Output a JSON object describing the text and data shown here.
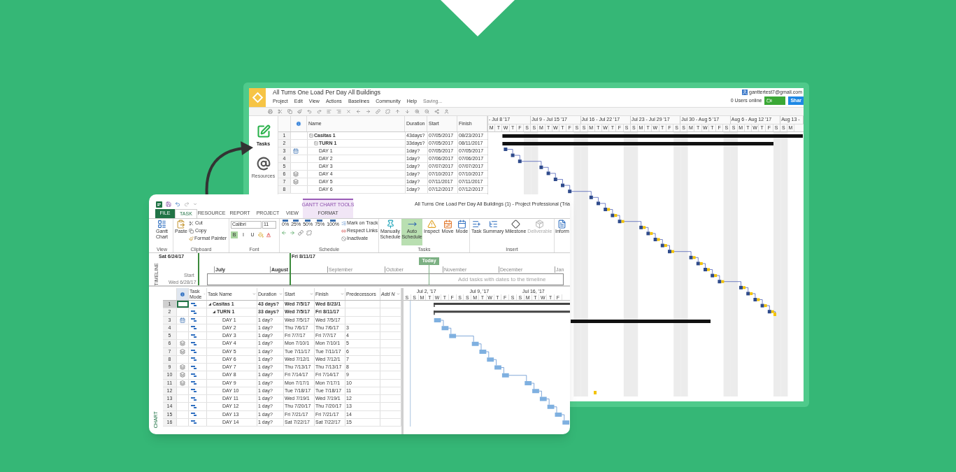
{
  "back_window": {
    "title": "All Turns One Load Per Day All Buildings",
    "menu": [
      "Project",
      "Edit",
      "View",
      "Actions",
      "Baselines",
      "Community",
      "Help"
    ],
    "status": "Saving...",
    "account": "ganttertest7@gmail.com",
    "users_online": "0 Users online",
    "share_button": "Shar",
    "sidebar": [
      {
        "label": "Tasks",
        "selected": true
      },
      {
        "label": "Resources",
        "selected": false
      }
    ],
    "table": {
      "columns": [
        "Name",
        "Duration",
        "Start",
        "Finish"
      ],
      "rows": [
        {
          "id": "1",
          "name": "Casitas 1",
          "duration": "43days?",
          "start": "07/05/2017",
          "finish": "08/23/2017",
          "kind": "summary",
          "expanded": true,
          "children": [
            {
              "id": "2",
              "name": "TURN 1",
              "duration": "33days?",
              "start": "07/05/2017",
              "finish": "08/11/2017",
              "kind": "summary",
              "expanded": true,
              "children": [
                {
                  "id": "3",
                  "name": "DAY 1",
                  "duration": "1day?",
                  "start": "07/05/2017",
                  "finish": "07/05/2017",
                  "kind": "calendar"
                },
                {
                  "id": "4",
                  "name": "DAY 2",
                  "duration": "1day?",
                  "start": "07/06/2017",
                  "finish": "07/06/2017",
                  "kind": "task"
                },
                {
                  "id": "5",
                  "name": "DAY 3",
                  "duration": "1day?",
                  "start": "07/07/2017",
                  "finish": "07/07/2017",
                  "kind": "task"
                },
                {
                  "id": "6",
                  "name": "DAY 4",
                  "duration": "1day?",
                  "start": "07/10/2017",
                  "finish": "07/10/2017",
                  "kind": "layers"
                },
                {
                  "id": "7",
                  "name": "DAY 5",
                  "duration": "1day?",
                  "start": "07/11/2017",
                  "finish": "07/11/2017",
                  "kind": "layers"
                },
                {
                  "id": "8",
                  "name": "DAY 6",
                  "duration": "1day?",
                  "start": "07/12/2017",
                  "finish": "07/12/2017",
                  "kind": "task"
                }
              ]
            }
          ]
        }
      ]
    },
    "gantt": {
      "weeks": [
        {
          "label": "- Jul 8 '17",
          "days": [
            "M",
            "T",
            "W",
            "T",
            "F",
            "S"
          ]
        },
        {
          "label": "Jul 9 - Jul 15 '17",
          "days": [
            "S",
            "M",
            "T",
            "W",
            "T",
            "F",
            "S"
          ]
        },
        {
          "label": "Jul 16 - Jul 22 '17",
          "days": [
            "S",
            "M",
            "T",
            "W",
            "T",
            "F",
            "S"
          ]
        },
        {
          "label": "Jul 23 - Jul 29 '17",
          "days": [
            "S",
            "M",
            "T",
            "W",
            "T",
            "F",
            "S"
          ]
        },
        {
          "label": "Jul 30 - Aug 5 '17",
          "days": [
            "S",
            "M",
            "T",
            "W",
            "T",
            "F",
            "S"
          ]
        },
        {
          "label": "Aug 6 - Aug 12 '17",
          "days": [
            "S",
            "M",
            "T",
            "W",
            "T",
            "F",
            "S"
          ]
        },
        {
          "label": "Aug 13 -",
          "days": [
            "S",
            "M"
          ]
        }
      ]
    }
  },
  "front_window": {
    "contextual_group": "GANTT CHART TOOLS",
    "title": "All Turns One Load Per Day All Buildings (1) - Project Professional (Tria",
    "tabs": [
      {
        "label": "FILE",
        "kind": "file",
        "selected": false
      },
      {
        "label": "TASK",
        "kind": "normal",
        "selected": true
      },
      {
        "label": "RESOURCE",
        "kind": "normal",
        "selected": false
      },
      {
        "label": "REPORT",
        "kind": "normal",
        "selected": false
      },
      {
        "label": "PROJECT",
        "kind": "normal",
        "selected": false
      },
      {
        "label": "VIEW",
        "kind": "normal",
        "selected": false
      },
      {
        "label": "FORMAT",
        "kind": "contextual",
        "selected": false
      }
    ],
    "ribbon": {
      "view": {
        "label": "View",
        "gantt_chart": "Gantt Chart"
      },
      "clipboard": {
        "label": "Clipboard",
        "paste": "Paste",
        "cut": "Cut",
        "copy": "Copy",
        "format_painter": "Format Painter"
      },
      "font": {
        "label": "Font",
        "font_name": "Calibri",
        "font_size": "11",
        "styles": [
          {
            "label": "B",
            "selected": true
          },
          {
            "label": "I",
            "selected": false
          },
          {
            "label": "U",
            "selected": false
          }
        ]
      },
      "schedule": {
        "label": "Schedule",
        "percent_buttons": [
          "0%",
          "25%",
          "50%",
          "75%",
          "100%"
        ],
        "mark_on_track": "Mark on Track",
        "respect_links": "Respect Links",
        "inactivate": "Inactivate"
      },
      "tasks": {
        "label": "Tasks",
        "schedule_modes": [
          {
            "label": "Manually Schedule",
            "selected": false
          },
          {
            "label": "Auto Schedule",
            "selected": true
          }
        ],
        "buttons": [
          "Inspect",
          "Move",
          "Mode"
        ]
      },
      "insert": {
        "label": "Insert",
        "buttons": [
          {
            "label": "Task",
            "disabled": false
          },
          {
            "label": "Summary",
            "disabled": false
          },
          {
            "label": "Milestone",
            "disabled": false
          },
          {
            "label": "Deliverable",
            "disabled": true
          }
        ]
      },
      "cut_button": "Inform"
    },
    "timeline": {
      "label": "TIMELINE",
      "start_date": "Sat 6/24/17",
      "finish_date": "Fri 8/11/17",
      "today": "Today",
      "months": [
        "July",
        "August",
        "September",
        "October",
        "November",
        "December",
        "Jan"
      ],
      "start_label": "Start",
      "start_value": "Wed 6/28/17",
      "placeholder": "Add tasks with dates to the timeline"
    },
    "table": {
      "columns": [
        "Task Mode",
        "Task Name",
        "Duration",
        "Start",
        "Finish",
        "Predecessors",
        "Add N"
      ],
      "rows": [
        {
          "id": "1",
          "name": "Casitas 1",
          "duration": "43 days?",
          "start": "Wed 7/5/17",
          "finish": "Wed 8/23/1",
          "kind": "summary",
          "selected": true,
          "expanded": true,
          "children": [
            {
              "id": "2",
              "name": "TURN 1",
              "duration": "33 days?",
              "start": "Wed 7/5/17",
              "finish": "Fri 8/11/17",
              "kind": "summary",
              "selected": false,
              "expanded": true,
              "children": [
                {
                  "id": "3",
                  "name": "DAY 1",
                  "duration": "1 day?",
                  "start": "Wed 7/5/17",
                  "finish": "Wed 7/5/17",
                  "kind": "calendar",
                  "selected": false
                },
                {
                  "id": "4",
                  "name": "DAY 2",
                  "duration": "1 day?",
                  "start": "Thu 7/6/17",
                  "finish": "Thu 7/6/17",
                  "predecessors": "3",
                  "kind": "task",
                  "selected": false
                },
                {
                  "id": "5",
                  "name": "DAY 3",
                  "duration": "1 day?",
                  "start": "Fri 7/7/17",
                  "finish": "Fri 7/7/17",
                  "predecessors": "4",
                  "kind": "task",
                  "selected": false
                },
                {
                  "id": "6",
                  "name": "DAY 4",
                  "duration": "1 day?",
                  "start": "Mon 7/10/1",
                  "finish": "Mon 7/10/1",
                  "predecessors": "5",
                  "kind": "layers",
                  "selected": false
                },
                {
                  "id": "7",
                  "name": "DAY 5",
                  "duration": "1 day?",
                  "start": "Tue 7/11/17",
                  "finish": "Tue 7/11/17",
                  "predecessors": "6",
                  "kind": "layers",
                  "selected": false
                },
                {
                  "id": "8",
                  "name": "DAY 6",
                  "duration": "1 day?",
                  "start": "Wed 7/12/1",
                  "finish": "Wed 7/12/1",
                  "predecessors": "7",
                  "kind": "task",
                  "selected": false
                },
                {
                  "id": "9",
                  "name": "DAY 7",
                  "duration": "1 day?",
                  "start": "Thu 7/13/17",
                  "finish": "Thu 7/13/17",
                  "predecessors": "8",
                  "kind": "layers",
                  "selected": false
                },
                {
                  "id": "10",
                  "name": "DAY 8",
                  "duration": "1 day?",
                  "start": "Fri 7/14/17",
                  "finish": "Fri 7/14/17",
                  "predecessors": "9",
                  "kind": "layers",
                  "selected": false
                },
                {
                  "id": "11",
                  "name": "DAY 9",
                  "duration": "1 day?",
                  "start": "Mon 7/17/1",
                  "finish": "Mon 7/17/1",
                  "predecessors": "10",
                  "kind": "layers",
                  "selected": false
                },
                {
                  "id": "12",
                  "name": "DAY 10",
                  "duration": "1 day?",
                  "start": "Tue 7/18/17",
                  "finish": "Tue 7/18/17",
                  "predecessors": "11",
                  "kind": "task",
                  "selected": false
                },
                {
                  "id": "13",
                  "name": "DAY 11",
                  "duration": "1 day?",
                  "start": "Wed 7/19/1",
                  "finish": "Wed 7/19/1",
                  "predecessors": "12",
                  "kind": "task",
                  "selected": false
                },
                {
                  "id": "14",
                  "name": "DAY 12",
                  "duration": "1 day?",
                  "start": "Thu 7/20/17",
                  "finish": "Thu 7/20/17",
                  "predecessors": "13",
                  "kind": "task",
                  "selected": false
                },
                {
                  "id": "15",
                  "name": "DAY 13",
                  "duration": "1 day?",
                  "start": "Fri 7/21/17",
                  "finish": "Fri 7/21/17",
                  "predecessors": "14",
                  "kind": "task",
                  "selected": false
                },
                {
                  "id": "16",
                  "name": "DAY 14",
                  "duration": "1 day?",
                  "start": "Sat 7/22/17",
                  "finish": "Sat 7/22/17",
                  "predecessors": "15",
                  "kind": "task",
                  "selected": false
                }
              ]
            }
          ]
        }
      ]
    },
    "gantt": {
      "weeks": [
        {
          "days": [
            "S"
          ]
        },
        {
          "label": "Jul 2, '17",
          "days": [
            "S",
            "M",
            "T",
            "W",
            "T",
            "F",
            "S"
          ]
        },
        {
          "label": "Jul 9, '17",
          "days": [
            "S",
            "M",
            "T",
            "W",
            "T",
            "F",
            "S"
          ]
        },
        {
          "label": "Jul 16, '17",
          "days": [
            "S",
            "M",
            "T",
            "W",
            "T",
            "F"
          ]
        }
      ]
    },
    "chart_label": "CHART"
  }
}
